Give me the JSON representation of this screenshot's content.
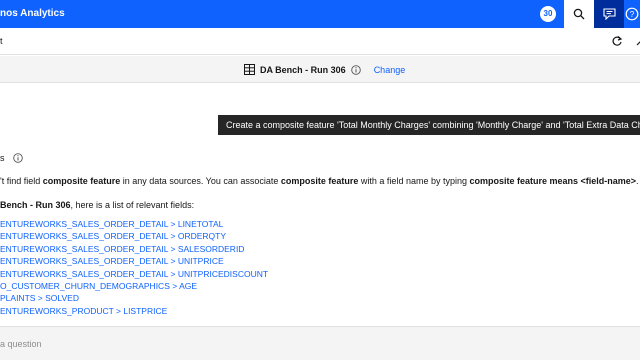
{
  "header": {
    "app_title": "nos Analytics",
    "notification_count": "30",
    "brand_color": "#0f62fe"
  },
  "toolbar": {
    "left_text": "t"
  },
  "dataset": {
    "name": "DA Bench - Run 306",
    "change_label": "Change"
  },
  "conversation": {
    "user_message": "Create a composite feature 'Total Monthly Charges' combining 'Monthly Charge' and 'Total Extra Data Cha",
    "response_header": "s",
    "response_text": {
      "p1": "'t find field ",
      "b1": "composite feature",
      "p2": " in any data sources. You can associate ",
      "b2": "composite feature",
      "p3": " with a field name by typing ",
      "b3": "composite feature means <field-name>",
      "p4": "."
    },
    "fields_intro": {
      "b": "Bench - Run 306",
      "rest": ", here is a list of relevant fields:"
    },
    "fields": [
      "ENTUREWORKS_SALES_ORDER_DETAIL > LINETOTAL",
      "ENTUREWORKS_SALES_ORDER_DETAIL > ORDERQTY",
      "ENTUREWORKS_SALES_ORDER_DETAIL > SALESORDERID",
      "ENTUREWORKS_SALES_ORDER_DETAIL > UNITPRICE",
      "ENTUREWORKS_SALES_ORDER_DETAIL > UNITPRICEDISCOUNT",
      "O_CUSTOMER_CHURN_DEMOGRAPHICS > AGE",
      "PLAINTS > SOLVED",
      "ENTUREWORKS_PRODUCT > LISTPRICE"
    ]
  },
  "input": {
    "placeholder": "a question"
  }
}
